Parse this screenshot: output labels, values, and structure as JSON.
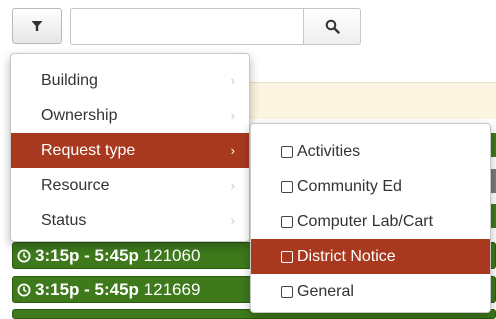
{
  "toolbar": {
    "filter_icon": "filter-icon",
    "search_placeholder": "",
    "search_value": "",
    "search_icon": "magnifier-icon"
  },
  "filter_menu": {
    "items": [
      {
        "label": "Building",
        "active": false
      },
      {
        "label": "Ownership",
        "active": false
      },
      {
        "label": "Request type",
        "active": true
      },
      {
        "label": "Resource",
        "active": false
      },
      {
        "label": "Status",
        "active": false
      }
    ],
    "chevron_glyph": "›"
  },
  "request_type_submenu": {
    "items": [
      {
        "label": "Activities",
        "checked": false,
        "highlighted": false
      },
      {
        "label": "Community Ed",
        "checked": false,
        "highlighted": false
      },
      {
        "label": "Computer Lab/Cart",
        "checked": false,
        "highlighted": false
      },
      {
        "label": "District Notice",
        "checked": false,
        "highlighted": true
      },
      {
        "label": "General",
        "checked": false,
        "highlighted": false
      }
    ]
  },
  "background_events": [
    {
      "time": "3:15p - 5:45p",
      "code": "121060"
    },
    {
      "time": "3:15p - 5:45p",
      "code": "121669"
    }
  ],
  "colors": {
    "highlight": "#a8391f",
    "event_green": "#3e7a1c",
    "banner": "#fbf5e1"
  }
}
